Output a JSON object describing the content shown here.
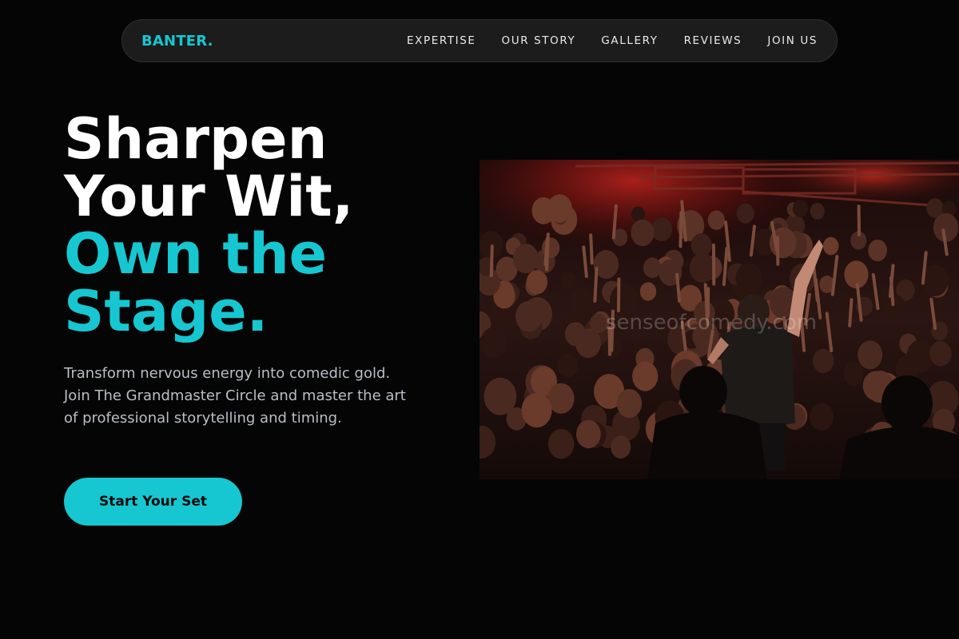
{
  "nav": {
    "logo": "BANTER.",
    "links": [
      "EXPERTISE",
      "OUR STORY",
      "GALLERY",
      "REVIEWS",
      "JOIN US"
    ]
  },
  "hero": {
    "headline_line1": "Sharpen",
    "headline_line2": "Your Wit,",
    "headline_accent_line1": "Own the",
    "headline_accent_line2": "Stage.",
    "description": "Transform nervous energy into comedic gold. Join The Grandmaster Circle and master the art of professional storytelling and timing.",
    "cta_label": "Start Your Set",
    "image_watermark": "senseofcomedy.com"
  },
  "colors": {
    "background": "#050505",
    "accent": "#16c7d1",
    "nav_background": "#1c1c1c",
    "body_text": "#b9bec6"
  },
  "icons": []
}
